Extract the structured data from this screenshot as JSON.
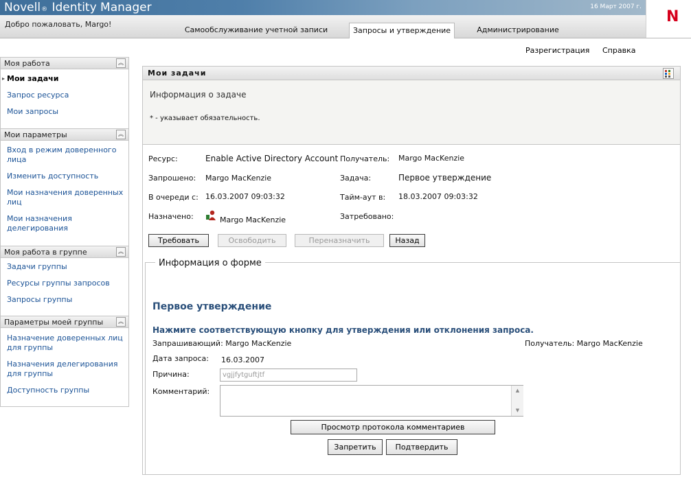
{
  "header": {
    "brand": "Novell",
    "brand_mark": "®",
    "product": "Identity Manager",
    "date": "16 Март 2007 г.",
    "welcome": "Добро пожаловать, Margo!",
    "logo_letter": "N",
    "tabs": [
      {
        "label": "Самообслуживание учетной записи",
        "active": false
      },
      {
        "label": "Запросы и утверждение",
        "active": true
      },
      {
        "label": "Администрирование",
        "active": false
      }
    ],
    "logout": "Разрегистрация",
    "help": "Справка"
  },
  "sidebar": {
    "sections": [
      {
        "title": "Моя работа",
        "items": [
          "Мои задачи",
          "Запрос ресурса",
          "Мои запросы"
        ]
      },
      {
        "title": "Мои параметры",
        "items": [
          "Вход в режим доверенного лица",
          "Изменить доступность",
          "Мои назначения доверенных лиц",
          "Мои назначения делегирования"
        ]
      },
      {
        "title": "Моя работа в группе",
        "items": [
          "Задачи группы",
          "Ресурсы группы запросов",
          "Запросы группы"
        ]
      },
      {
        "title": "Параметры моей группы",
        "items": [
          "Назначение доверенных лиц для группы",
          "Назначения делегирования для группы",
          "Доступность группы"
        ]
      }
    ],
    "current": "Мои задачи"
  },
  "panel": {
    "title": "Мои задачи",
    "subtitle": "Информация о задаче",
    "required_note": "* - указывает обязательность."
  },
  "task": {
    "resource_label": "Ресурс:",
    "resource_value": "Enable Active Directory Account",
    "recipient_label": "Получатель:",
    "recipient_value": "Margo MacKenzie",
    "requested_label": "Запрошено:",
    "requested_value": "Margo MacKenzie",
    "task_label": "Задача:",
    "task_value": "Первое утверждение",
    "queued_label": "В очереди с:",
    "queued_value": "16.03.2007 09:03:32",
    "timeout_label": "Тайм-аут в:",
    "timeout_value": "18.03.2007 09:03:32",
    "assigned_label": "Назначено:",
    "assigned_value": "Margo MacKenzie",
    "claimed_label": "Затребовано:",
    "claimed_value": ""
  },
  "actions": {
    "claim": "Требовать",
    "release": "Освободить",
    "reassign": "Переназначить",
    "back": "Назад"
  },
  "form": {
    "legend": "Информация о форме",
    "title": "Первое утверждение",
    "instruction": "Нажмите соответствующую кнопку для утверждения или отклонения запроса.",
    "requester": "Запрашивающий: Margo MacKenzie",
    "recipient": "Получатель: Margo MacKenzie",
    "request_date_label": "Дата запроса:",
    "request_date_value": "16.03.2007",
    "reason_label": "Причина:",
    "reason_value": "vgjjfytguftjtf",
    "comment_label": "Комментарий:",
    "comment_value": "",
    "view_history": "Просмотр протокола комментариев",
    "deny": "Запретить",
    "approve": "Подтвердить"
  },
  "colors": {
    "link": "#1a5296",
    "form_heading": "#2a4f7a",
    "brand_bar": "#3f6f9a",
    "logo": "#d6001c"
  }
}
